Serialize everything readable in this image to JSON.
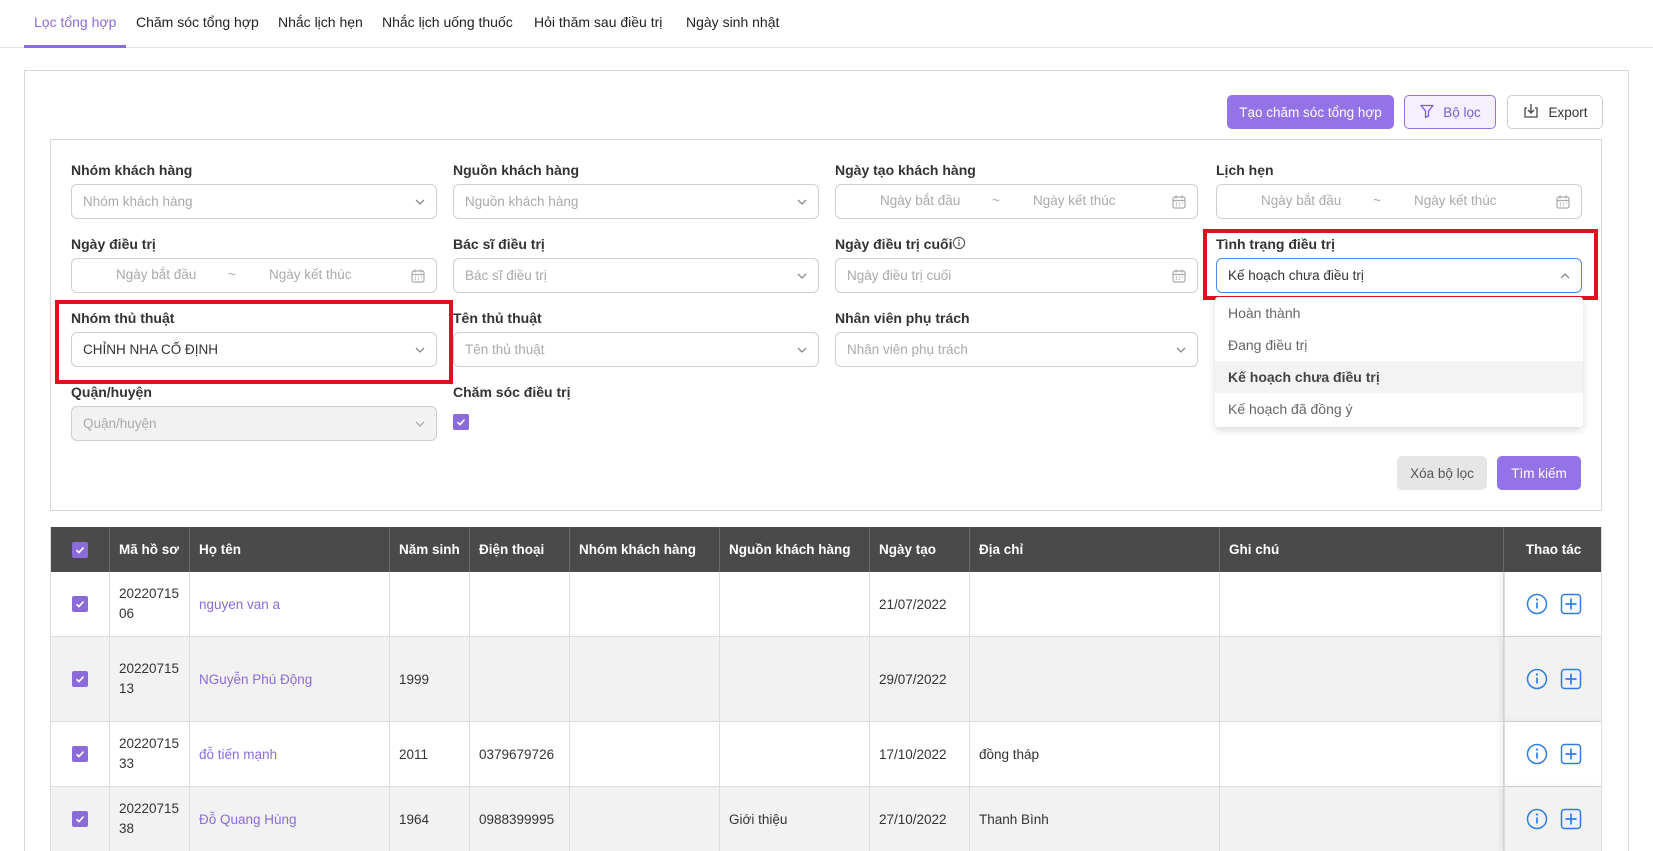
{
  "tabs": [
    {
      "label": "Lọc tổng hợp"
    },
    {
      "label": "Chăm sóc tổng hợp"
    },
    {
      "label": "Nhắc lịch hẹn"
    },
    {
      "label": "Nhắc lịch uống thuốc"
    },
    {
      "label": "Hỏi thăm sau điều trị"
    },
    {
      "label": "Ngày sinh nhật"
    }
  ],
  "active_tab": "Lọc tổng hợp",
  "toolbar": {
    "create_label": "Tạo chăm sóc tổng hợp",
    "filter_label": "Bộ lọc",
    "export_label": "Export"
  },
  "filters": {
    "customer_group": {
      "label": "Nhóm khách hàng",
      "placeholder": "Nhóm khách hàng"
    },
    "customer_source": {
      "label": "Nguồn khách hàng",
      "placeholder": "Nguồn khách hàng"
    },
    "customer_created_date": {
      "label": "Ngày tạo khách hàng",
      "start_placeholder": "Ngày bắt đầu",
      "end_placeholder": "Ngày kết thúc"
    },
    "appointment": {
      "label": "Lịch hẹn",
      "start_placeholder": "Ngày bắt đầu",
      "end_placeholder": "Ngày kết thúc"
    },
    "treatment_date": {
      "label": "Ngày điều trị",
      "start_placeholder": "Ngày bắt đầu",
      "end_placeholder": "Ngày kết thúc"
    },
    "doctor": {
      "label": "Bác sĩ điều trị",
      "placeholder": "Bác sĩ điều trị"
    },
    "last_treatment_date": {
      "label": "Ngày điều trị cuối",
      "placeholder": "Ngày điều trị cuối"
    },
    "treatment_status": {
      "label": "Tình trạng điều trị",
      "value": "Kế hoạch chưa điều trị"
    },
    "procedure_group": {
      "label": "Nhóm thủ thuật",
      "value": "CHỈNH NHA CỐ ĐỊNH"
    },
    "procedure_name": {
      "label": "Tên thủ thuật",
      "placeholder": "Tên thủ thuật"
    },
    "staff": {
      "label": "Nhân viên phụ trách",
      "placeholder": "Nhân viên phụ trách"
    },
    "district": {
      "label": "Quận/huyện",
      "placeholder": "Quận/huyện"
    },
    "treatment_care": {
      "label": "Chăm sóc điều trị",
      "checked": true
    },
    "clear_label": "Xóa bộ lọc",
    "search_label": "Tìm kiếm"
  },
  "status_dropdown": {
    "options": [
      "Hoàn thành",
      "Đang điều trị",
      "Kế hoạch chưa điều trị",
      "Kế hoạch đã đồng ý"
    ],
    "selected": "Kế hoạch chưa điều trị"
  },
  "table": {
    "columns": [
      "Mã hồ sơ",
      "Họ tên",
      "Năm sinh",
      "Điện thoại",
      "Nhóm khách hàng",
      "Nguồn khách hàng",
      "Ngày tạo",
      "Địa chỉ",
      "Ghi chú",
      "Thao tác"
    ],
    "rows": [
      {
        "code": "2022071506",
        "name": "nguyen van a",
        "birth_year": "",
        "phone": "",
        "group": "",
        "source": "",
        "created": "21/07/2022",
        "address": "",
        "note": "",
        "checked": true
      },
      {
        "code": "2022071513",
        "name": "NGuyễn Phú Động",
        "birth_year": "1999",
        "phone": "",
        "group": "",
        "source": "",
        "created": "29/07/2022",
        "address": "",
        "note": "",
        "checked": true
      },
      {
        "code": "2022071533",
        "name": "đỗ tiến mạnh",
        "birth_year": "2011",
        "phone": "0379679726",
        "group": "",
        "source": "",
        "created": "17/10/2022",
        "address": "đồng tháp",
        "note": "",
        "checked": true
      },
      {
        "code": "2022071538",
        "name": "Đỗ Quang Hùng",
        "birth_year": "1964",
        "phone": "0988399995",
        "group": "",
        "source": "Giới thiệu",
        "created": "27/10/2022",
        "address": "Thanh Bình",
        "note": "",
        "checked": true
      }
    ]
  },
  "colors": {
    "accent": "#8b6bd9",
    "header_bg": "#4a4a4a",
    "highlight": "#e0101e",
    "icon_blue": "#2f7de1"
  }
}
